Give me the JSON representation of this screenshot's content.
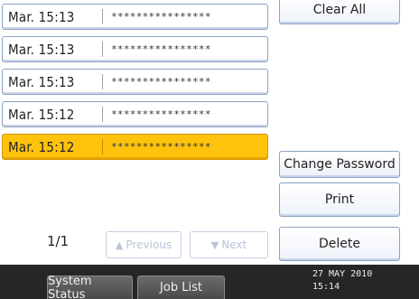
{
  "files": [
    {
      "date": "Mar. 15:13",
      "name": "****************",
      "selected": false
    },
    {
      "date": "Mar. 15:13",
      "name": "****************",
      "selected": false
    },
    {
      "date": "Mar. 15:13",
      "name": "****************",
      "selected": false
    },
    {
      "date": "Mar. 15:12",
      "name": "****************",
      "selected": false
    },
    {
      "date": "Mar. 15:12",
      "name": "****************",
      "selected": true
    }
  ],
  "buttons": {
    "clear_all": "Clear All",
    "change_password": "Change Password",
    "print": "Print",
    "delete": "Delete"
  },
  "pagination": {
    "page": "1/1",
    "previous": "Previous",
    "next": "Next",
    "previous_icon": "▲",
    "next_icon": "▼"
  },
  "statusbar": {
    "system_status": "System Status",
    "job_list": "Job List",
    "date": "27 MAY  2010",
    "time": "15:14"
  },
  "colors": {
    "selected_row": "#ffc30d",
    "statusbar": "#262626"
  }
}
